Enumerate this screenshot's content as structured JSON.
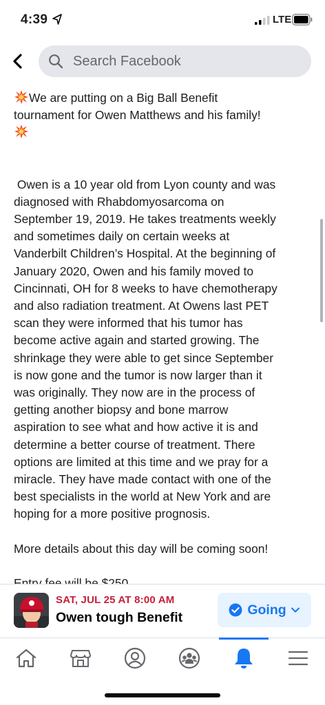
{
  "status_bar": {
    "time": "4:39",
    "network": "LTE"
  },
  "search": {
    "placeholder": "Search Facebook"
  },
  "post": {
    "intro_line1": "We are putting on a Big Ball Benefit",
    "intro_line2": "tournament for Owen Matthews and his family!",
    "body": " Owen is a 10 year old from Lyon county and was\ndiagnosed with Rhabdomyosarcoma on\nSeptember 19, 2019. He takes treatments weekly\nand sometimes daily on certain weeks at\nVanderbilt Children’s Hospital. At the beginning of\nJanuary 2020, Owen and his family moved to\nCincinnati, OH for 8 weeks to have chemotherapy\nand also radiation treatment. At Owens last PET\nscan they were informed that his tumor has\nbecome active again and started growing. The\nshrinkage they were able to get since September\nis now gone and the tumor is now larger than it\nwas originally. They now are in the process of\ngetting another biopsy and bone marrow\naspiration to see what and how active it is and\ndetermine a better course of treatment. There\noptions are limited at this time and we pray for a\nmiracle. They have made contact with one of the\nbest specialists in the world at New York and are\nhoping for a more positive prognosis.",
    "details": "More details about this day will be coming soon!",
    "cut_off": "Entry fee will be $250"
  },
  "event": {
    "date": "SAT, JUL 25 AT 8:00 AM",
    "title": "Owen tough Benefit",
    "rsvp_label": "Going"
  },
  "tabs": [
    {
      "icon": "home-icon"
    },
    {
      "icon": "marketplace-icon"
    },
    {
      "icon": "profile-icon"
    },
    {
      "icon": "groups-icon"
    },
    {
      "icon": "notifications-icon",
      "active": true
    },
    {
      "icon": "menu-icon"
    }
  ],
  "colors": {
    "accent": "#1877f2",
    "event_date": "#c5203a",
    "search_bg": "#e4e6eb",
    "going_bg": "#e7f3ff"
  }
}
